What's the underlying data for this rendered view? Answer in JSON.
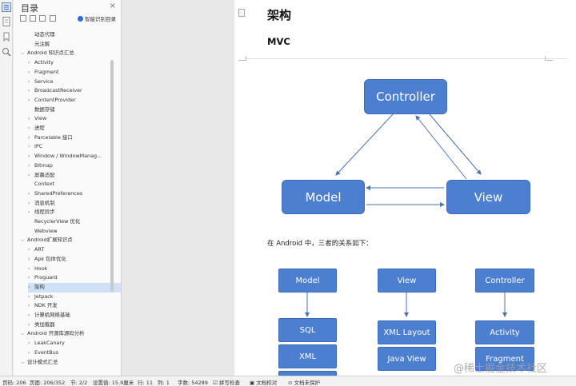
{
  "sidebar_panel": {
    "title": "目录",
    "close_glyph": "×",
    "smart_label": "智能识别目录",
    "items": [
      {
        "label": "动态代理",
        "level": 1,
        "expandable": false
      },
      {
        "label": "元注解",
        "level": 1,
        "expandable": false
      },
      {
        "label": "Android 知识点汇总",
        "level": 0,
        "expandable": true,
        "expanded": true
      },
      {
        "label": "Activity",
        "level": 1,
        "expandable": true
      },
      {
        "label": "Fragment",
        "level": 1,
        "expandable": true
      },
      {
        "label": "Service",
        "level": 1,
        "expandable": true
      },
      {
        "label": "BroadcastReceiver",
        "level": 1,
        "expandable": true
      },
      {
        "label": "ContentProvider",
        "level": 1,
        "expandable": true
      },
      {
        "label": "数据存储",
        "level": 1,
        "expandable": false
      },
      {
        "label": "View",
        "level": 1,
        "expandable": true
      },
      {
        "label": "进程",
        "level": 1,
        "expandable": true
      },
      {
        "label": "Parcelable 接口",
        "level": 1,
        "expandable": true
      },
      {
        "label": "IPC",
        "level": 1,
        "expandable": true
      },
      {
        "label": "Window / WindowManag...",
        "level": 1,
        "expandable": true
      },
      {
        "label": "Bitmap",
        "level": 1,
        "expandable": true
      },
      {
        "label": "屏幕适配",
        "level": 1,
        "expandable": true
      },
      {
        "label": "Context",
        "level": 1,
        "expandable": false
      },
      {
        "label": "SharedPreferences",
        "level": 1,
        "expandable": true
      },
      {
        "label": "消息机制",
        "level": 1,
        "expandable": true
      },
      {
        "label": "线程异步",
        "level": 1,
        "expandable": true
      },
      {
        "label": "RecyclerView 优化",
        "level": 1,
        "expandable": false
      },
      {
        "label": "Webview",
        "level": 1,
        "expandable": false
      },
      {
        "label": "Android扩展知识点",
        "level": 0,
        "expandable": true,
        "expanded": true
      },
      {
        "label": "ART",
        "level": 1,
        "expandable": true
      },
      {
        "label": "Apk 包体优化",
        "level": 1,
        "expandable": true
      },
      {
        "label": "Hook",
        "level": 1,
        "expandable": true
      },
      {
        "label": "Proguard",
        "level": 1,
        "expandable": true
      },
      {
        "label": "架构",
        "level": 1,
        "expandable": true,
        "selected": true
      },
      {
        "label": "Jetpack",
        "level": 1,
        "expandable": true
      },
      {
        "label": "NDK 开发",
        "level": 1,
        "expandable": true
      },
      {
        "label": "计算机网络基础",
        "level": 1,
        "expandable": true
      },
      {
        "label": "类加载器",
        "level": 1,
        "expandable": true
      },
      {
        "label": "Android 开源库源码分析",
        "level": 0,
        "expandable": true,
        "expanded": true
      },
      {
        "label": "LeakCanary",
        "level": 1,
        "expandable": true
      },
      {
        "label": "EventBus",
        "level": 1,
        "expandable": true
      },
      {
        "label": "设计模式汇总",
        "level": 0,
        "expandable": true,
        "expanded": true
      }
    ]
  },
  "document": {
    "heading": "架构",
    "subheading": "MVC",
    "diagram": {
      "controller": "Controller",
      "model": "Model",
      "view": "View"
    },
    "paragraph": "在 Android 中，三者的关系如下：",
    "columns": {
      "model": {
        "header": "Model",
        "items": [
          "SQL",
          "XML"
        ]
      },
      "view": {
        "header": "View",
        "items": [
          "XML Layout",
          "Java View"
        ]
      },
      "controller": {
        "header": "Controller",
        "items": [
          "Activity",
          "Fragment"
        ]
      }
    }
  },
  "status_bar": {
    "page_no": "页码: 206",
    "pages": "页面: 206/352",
    "section": "节: 2/2",
    "setting": "设置值: 15.9厘米",
    "row": "行: 11",
    "col": "列: 1",
    "word_count": "字数: 54289",
    "spell_check": "拼写检查",
    "proofread": "文档校对",
    "protection": "文档未保护"
  },
  "watermark": "@稀土掘金技术社区"
}
